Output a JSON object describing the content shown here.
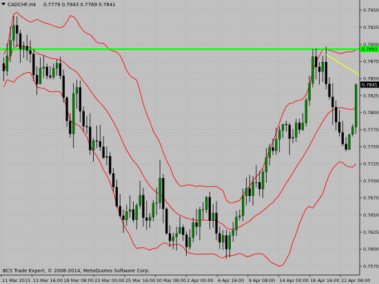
{
  "chart_header": {
    "symbol": "CADCHF,H4",
    "ohlc": "0.7779 0.7843 0.7769 0.7841"
  },
  "footer": {
    "copyright": "BCS Trade Expert, © 2006-2014, MetaQuotes Software Corp."
  },
  "colors": {
    "background": "#c0c0c0",
    "candle_bull": "#008000",
    "candle_bear": "#000000",
    "wick": "#000000",
    "bands": "#ff0000",
    "horizontal_line": "#00ff00",
    "trendline": "#ffff00",
    "grid": "#9a9a9a",
    "current_price_bg": "#000000",
    "current_price_text": "#ffffff"
  },
  "chart_data": {
    "type": "candlestick",
    "title": "CADCHF,H4",
    "ylim": [
      0.7562,
      0.7965
    ],
    "y_ticks": [
      "0.7950",
      "0.7925",
      "0.7900",
      "0.7875",
      "0.7850",
      "0.7825",
      "0.7800",
      "0.7775",
      "0.7750",
      "0.7725",
      "0.7700",
      "0.7675",
      "0.7650",
      "0.7625",
      "0.7600",
      "0.7575"
    ],
    "x_ticks": [
      "11 Mar 2015",
      "13 Mar 16:00",
      "18 Mar 08:00",
      "23 Mar 00:00",
      "25 Mar 16:00",
      "30 Mar 08:00",
      "2 Apr 00:00",
      "6 Apr 16:00",
      "9 Apr 08:00",
      "14 Apr 00:00",
      "16 Apr 16:00",
      "21 Apr 08:00"
    ],
    "horizontal_level": {
      "value": 0.7893,
      "label": "0.7893"
    },
    "current_price": {
      "value": 0.7841,
      "label": "0.7841"
    },
    "trendline": {
      "from": 0.7885,
      "to": 0.7855
    },
    "indicator": "Bollinger Bands",
    "candles": [
      [
        0.7872,
        0.7881,
        0.7846,
        0.7861
      ],
      [
        0.7861,
        0.7901,
        0.7854,
        0.7883
      ],
      [
        0.7883,
        0.7926,
        0.7874,
        0.7906
      ],
      [
        0.7906,
        0.7942,
        0.7897,
        0.7928
      ],
      [
        0.7928,
        0.7941,
        0.7896,
        0.7916
      ],
      [
        0.7916,
        0.7921,
        0.7873,
        0.7893
      ],
      [
        0.7893,
        0.7904,
        0.788,
        0.7897
      ],
      [
        0.7897,
        0.7914,
        0.7876,
        0.7891
      ],
      [
        0.7891,
        0.7906,
        0.7873,
        0.7886
      ],
      [
        0.7886,
        0.7893,
        0.7846,
        0.7855
      ],
      [
        0.7855,
        0.7868,
        0.7826,
        0.7842
      ],
      [
        0.7842,
        0.7881,
        0.7842,
        0.7865
      ],
      [
        0.7865,
        0.7884,
        0.7851,
        0.7867
      ],
      [
        0.7867,
        0.7872,
        0.7849,
        0.7854
      ],
      [
        0.7854,
        0.7868,
        0.7849,
        0.7852
      ],
      [
        0.7852,
        0.7872,
        0.7849,
        0.7865
      ],
      [
        0.7865,
        0.7878,
        0.7854,
        0.7872
      ],
      [
        0.7872,
        0.7882,
        0.7849,
        0.7854
      ],
      [
        0.7854,
        0.7863,
        0.7815,
        0.7822
      ],
      [
        0.7822,
        0.7824,
        0.7779,
        0.7788
      ],
      [
        0.7788,
        0.7799,
        0.7763,
        0.7769
      ],
      [
        0.7769,
        0.7843,
        0.7748,
        0.7828
      ],
      [
        0.7828,
        0.7848,
        0.7806,
        0.7837
      ],
      [
        0.7837,
        0.7847,
        0.7786,
        0.7802
      ],
      [
        0.7802,
        0.7809,
        0.7772,
        0.778
      ],
      [
        0.778,
        0.7795,
        0.7769,
        0.7779
      ],
      [
        0.7779,
        0.7799,
        0.7738,
        0.7745
      ],
      [
        0.7745,
        0.7763,
        0.7728,
        0.7759
      ],
      [
        0.7759,
        0.7781,
        0.7748,
        0.7758
      ],
      [
        0.7758,
        0.7782,
        0.7744,
        0.775
      ],
      [
        0.775,
        0.7766,
        0.7732,
        0.7734
      ],
      [
        0.7734,
        0.775,
        0.7723,
        0.7736
      ],
      [
        0.7736,
        0.7742,
        0.7708,
        0.7711
      ],
      [
        0.7711,
        0.7719,
        0.7684,
        0.7691
      ],
      [
        0.7691,
        0.7702,
        0.7661,
        0.7663
      ],
      [
        0.7663,
        0.7681,
        0.7646,
        0.7649
      ],
      [
        0.7649,
        0.7658,
        0.7624,
        0.7643
      ],
      [
        0.7643,
        0.7665,
        0.7634,
        0.7655
      ],
      [
        0.7655,
        0.7679,
        0.7646,
        0.7658
      ],
      [
        0.7658,
        0.767,
        0.7639,
        0.7643
      ],
      [
        0.7643,
        0.7667,
        0.7629,
        0.7664
      ],
      [
        0.7664,
        0.77,
        0.7659,
        0.7679
      ],
      [
        0.7679,
        0.769,
        0.7633,
        0.7646
      ],
      [
        0.7646,
        0.7671,
        0.7628,
        0.7642
      ],
      [
        0.7642,
        0.7653,
        0.7631,
        0.7647
      ],
      [
        0.7647,
        0.7672,
        0.7641,
        0.7667
      ],
      [
        0.7667,
        0.769,
        0.765,
        0.7668
      ],
      [
        0.7668,
        0.7731,
        0.7659,
        0.7704
      ],
      [
        0.7704,
        0.771,
        0.7638,
        0.7659
      ],
      [
        0.7659,
        0.7661,
        0.7621,
        0.7623
      ],
      [
        0.7623,
        0.7635,
        0.7603,
        0.7612
      ],
      [
        0.7612,
        0.7624,
        0.76,
        0.7618
      ],
      [
        0.7618,
        0.7633,
        0.7598,
        0.7623
      ],
      [
        0.7623,
        0.7648,
        0.7622,
        0.7632
      ],
      [
        0.7632,
        0.7636,
        0.7612,
        0.7621
      ],
      [
        0.7621,
        0.7626,
        0.759,
        0.7603
      ],
      [
        0.7603,
        0.7629,
        0.7599,
        0.7617
      ],
      [
        0.7617,
        0.7646,
        0.761,
        0.7639
      ],
      [
        0.7639,
        0.7659,
        0.762,
        0.7633
      ],
      [
        0.7633,
        0.7662,
        0.7613,
        0.7658
      ],
      [
        0.7658,
        0.7669,
        0.7643,
        0.7658
      ],
      [
        0.7658,
        0.7678,
        0.7653,
        0.7676
      ],
      [
        0.7676,
        0.7684,
        0.7629,
        0.7642
      ],
      [
        0.7642,
        0.7666,
        0.7631,
        0.7653
      ],
      [
        0.7653,
        0.767,
        0.7613,
        0.7623
      ],
      [
        0.7623,
        0.7633,
        0.76,
        0.761
      ],
      [
        0.761,
        0.7628,
        0.7599,
        0.762
      ],
      [
        0.762,
        0.7628,
        0.7586,
        0.76
      ],
      [
        0.76,
        0.7626,
        0.7588,
        0.762
      ],
      [
        0.762,
        0.764,
        0.7611,
        0.7628
      ],
      [
        0.7628,
        0.7656,
        0.7619,
        0.7647
      ],
      [
        0.7647,
        0.7658,
        0.7642,
        0.7649
      ],
      [
        0.7649,
        0.7689,
        0.7641,
        0.7678
      ],
      [
        0.7678,
        0.7705,
        0.7664,
        0.7689
      ],
      [
        0.7689,
        0.7709,
        0.7669,
        0.7678
      ],
      [
        0.7678,
        0.7707,
        0.7664,
        0.7698
      ],
      [
        0.7698,
        0.7723,
        0.769,
        0.7698
      ],
      [
        0.7698,
        0.7714,
        0.7678,
        0.7688
      ],
      [
        0.7688,
        0.7718,
        0.7675,
        0.7713
      ],
      [
        0.7713,
        0.7748,
        0.7697,
        0.7734
      ],
      [
        0.7734,
        0.7754,
        0.7723,
        0.7749
      ],
      [
        0.7749,
        0.7762,
        0.7738,
        0.7744
      ],
      [
        0.7744,
        0.7778,
        0.7738,
        0.7761
      ],
      [
        0.7761,
        0.778,
        0.7742,
        0.7774
      ],
      [
        0.7774,
        0.7783,
        0.7763,
        0.7783
      ],
      [
        0.7783,
        0.7788,
        0.7772,
        0.7782
      ],
      [
        0.7782,
        0.7785,
        0.7738,
        0.7762
      ],
      [
        0.7762,
        0.7776,
        0.7755,
        0.7764
      ],
      [
        0.7764,
        0.7791,
        0.7757,
        0.7785
      ],
      [
        0.7785,
        0.7791,
        0.7769,
        0.7775
      ],
      [
        0.7775,
        0.7799,
        0.7773,
        0.7785
      ],
      [
        0.7785,
        0.7822,
        0.778,
        0.7818
      ],
      [
        0.7818,
        0.7854,
        0.781,
        0.7843
      ],
      [
        0.7843,
        0.7893,
        0.7837,
        0.7882
      ],
      [
        0.7882,
        0.7894,
        0.7849,
        0.7867
      ],
      [
        0.7867,
        0.7874,
        0.7841,
        0.786
      ],
      [
        0.786,
        0.7883,
        0.7845,
        0.7874
      ],
      [
        0.7874,
        0.7897,
        0.7834,
        0.7842
      ],
      [
        0.7842,
        0.7852,
        0.7819,
        0.7823
      ],
      [
        0.7823,
        0.7843,
        0.7782,
        0.7808
      ],
      [
        0.7808,
        0.7818,
        0.7774,
        0.7786
      ],
      [
        0.7786,
        0.7804,
        0.7765,
        0.7771
      ],
      [
        0.7771,
        0.7788,
        0.7751,
        0.7754
      ],
      [
        0.7754,
        0.7764,
        0.7743,
        0.7746
      ],
      [
        0.7746,
        0.7769,
        0.7745,
        0.7768
      ],
      [
        0.7768,
        0.7783,
        0.7765,
        0.7779
      ],
      [
        0.7779,
        0.7843,
        0.7769,
        0.7841
      ]
    ]
  }
}
